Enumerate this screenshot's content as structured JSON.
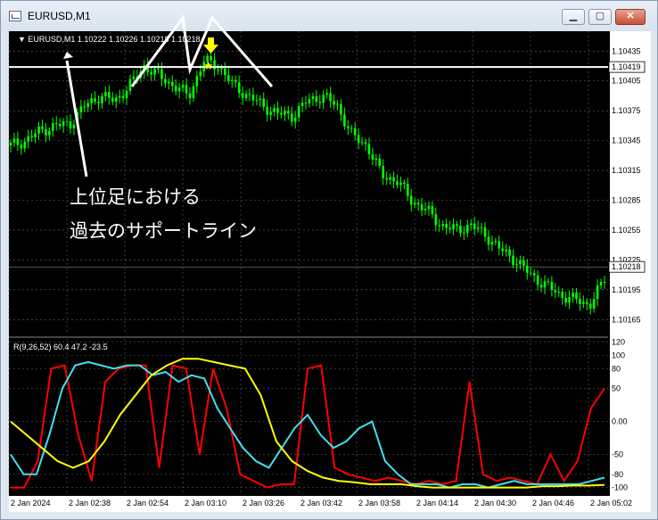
{
  "window": {
    "title": "EURUSD,M1",
    "min_glyph": "▁",
    "max_glyph": "▢",
    "close_glyph": "✕"
  },
  "header": {
    "symbol_label": "▼ EURUSD,M1  1.10222 1.10226 1.10218 1.10218"
  },
  "price_axis": {
    "ticks": [
      "1.10435",
      "1.10405",
      "1.10375",
      "1.10345",
      "1.10315",
      "1.10285",
      "1.10255",
      "1.10225",
      "1.10195",
      "1.10165"
    ],
    "highlight_labels": [
      "1.10419",
      "1.10218"
    ]
  },
  "indicator": {
    "label": "R(9,26,52) 60.4 47.2 -23.5",
    "ticks": [
      "120",
      "100",
      "80",
      "50",
      "0.00",
      "-50",
      "-80",
      "-100"
    ]
  },
  "time_axis": {
    "labels": [
      "2 Jan 2024",
      "2 Jan 02:38",
      "2 Jan 02:54",
      "2 Jan 03:10",
      "2 Jan 03:26",
      "2 Jan 03:42",
      "2 Jan 03:58",
      "2 Jan 04:14",
      "2 Jan 04:30",
      "2 Jan 04:46",
      "2 Jan 05:02"
    ]
  },
  "annotation": {
    "line1": "上位足における",
    "line2": "過去のサポートライン"
  },
  "colors": {
    "candle": "#00ff00",
    "support_line": "#ffffff",
    "red": "#ff0000",
    "cyan": "#40e0f0",
    "yellow": "#ffff00",
    "arrow": "#ffff00"
  },
  "chart_data": {
    "type": "line",
    "price": {
      "ylim": [
        1.1015,
        1.10455
      ],
      "support_level": 1.10419,
      "current": 1.10218,
      "close_series": [
        1.1034,
        1.10345,
        1.10355,
        1.1036,
        1.10362,
        1.1038,
        1.1039,
        1.10385,
        1.104,
        1.1042,
        1.1041,
        1.104,
        1.1039,
        1.10425,
        1.1042,
        1.104,
        1.1039,
        1.1038,
        1.10372,
        1.1037,
        1.10385,
        1.1039,
        1.1038,
        1.1035,
        1.1034,
        1.1031,
        1.10305,
        1.10285,
        1.10275,
        1.1026,
        1.10255,
        1.1026,
        1.1025,
        1.10235,
        1.10225,
        1.1021,
        1.102,
        1.1019,
        1.10185,
        1.1018,
        1.10205
      ]
    },
    "oscillator": {
      "ylim": [
        -110,
        125
      ],
      "series": [
        {
          "color": "red",
          "values": [
            -100,
            -100,
            -60,
            80,
            85,
            -20,
            -90,
            60,
            80,
            85,
            85,
            -70,
            85,
            80,
            -50,
            80,
            20,
            -80,
            -90,
            -100,
            -95,
            -95,
            80,
            85,
            -70,
            -80,
            -85,
            -90,
            -85,
            -90,
            -95,
            -90,
            -95,
            -90,
            60,
            -80,
            -90,
            -85,
            -90,
            -95,
            -50,
            -90,
            -60,
            20,
            50
          ]
        },
        {
          "color": "cyan",
          "values": [
            -50,
            -80,
            -80,
            -20,
            50,
            85,
            90,
            85,
            80,
            85,
            85,
            70,
            75,
            60,
            70,
            65,
            20,
            -10,
            -40,
            -60,
            -70,
            -40,
            -10,
            10,
            -20,
            -40,
            -30,
            -10,
            0,
            -60,
            -80,
            -95,
            -95,
            -95,
            -100,
            -95,
            -95,
            -100,
            -95,
            -90,
            -95,
            -95,
            -95,
            -95,
            -95,
            -90,
            -85
          ]
        },
        {
          "color": "yellow",
          "values": [
            0,
            -20,
            -40,
            -60,
            -70,
            -60,
            -30,
            10,
            40,
            70,
            85,
            95,
            95,
            90,
            85,
            80,
            40,
            -30,
            -60,
            -75,
            -85,
            -90,
            -92,
            -95,
            -95,
            -95,
            -98,
            -100,
            -100,
            -100,
            -100,
            -100,
            -100,
            -100,
            -98,
            -98,
            -97,
            -97,
            -96
          ]
        }
      ]
    }
  }
}
